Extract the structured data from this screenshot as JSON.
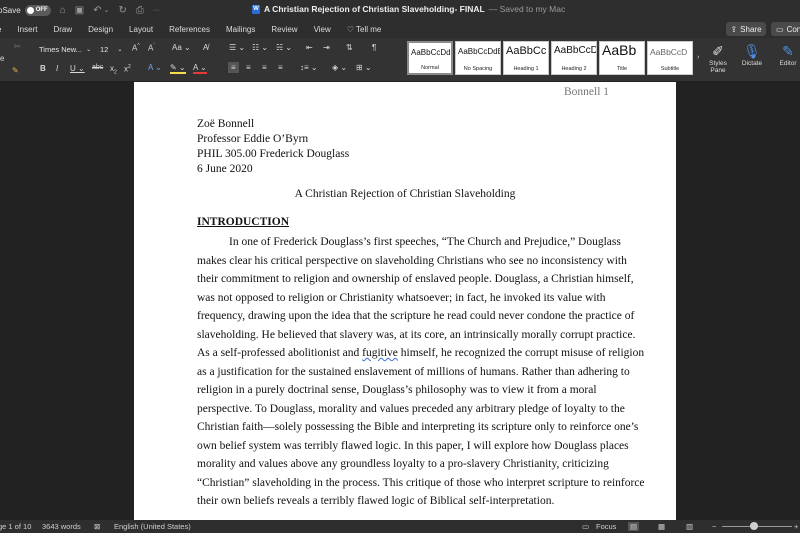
{
  "titlebar": {
    "autosave_label": "oSave",
    "autosave_toggle": "OFF",
    "doc_name": "A Christian Rejection of Christian Slaveholding- FINAL",
    "saved_status": "— Saved to my Mac",
    "word_icon_letter": "W"
  },
  "tabs": [
    "e",
    "Insert",
    "Draw",
    "Design",
    "Layout",
    "References",
    "Mailings",
    "Review",
    "View"
  ],
  "tell_me": "Tell me",
  "share_label": "Share",
  "comments_label": "Con",
  "ribbon": {
    "font_name": "Times New...",
    "font_size": "12",
    "styles": [
      {
        "sample": "AaBbCcDdEe",
        "name": "Normal",
        "active": true
      },
      {
        "sample": "AaBbCcDdEe",
        "name": "No Spacing"
      },
      {
        "sample": "AaBbCc",
        "name": "Heading 1"
      },
      {
        "sample": "AaBbCcD",
        "name": "Heading 2"
      },
      {
        "sample": "AaBb",
        "name": "Title"
      },
      {
        "sample": "AaBbCcD",
        "name": "Subtitle"
      }
    ],
    "styles_pane": "Styles\nPane",
    "dictate": "Dictate",
    "editor": "Editor"
  },
  "document": {
    "page_header": "Bonnell 1",
    "author": "Zoë Bonnell",
    "professor": "Professor Eddie O’Byrn",
    "course": "PHIL 305.00 Frederick Douglass",
    "date": "6 June 2020",
    "title": "A Christian Rejection of Christian Slaveholding",
    "section_heading": "INTRODUCTION",
    "lines": [
      "In one of Frederick Douglass’s first speeches, “The Church and Prejudice,” Douglass",
      "makes clear his critical perspective on slaveholding Christians who see no inconsistency with",
      "their commitment to religion and ownership of enslaved people. Douglass, a Christian himself,",
      "was not opposed to religion or Christianity whatsoever; in fact, he invoked its value with",
      "frequency, drawing upon the idea that the scripture he read could never condone the practice of",
      "slaveholding. He believed that slavery was, at its core, an intrinsically morally corrupt practice.",
      "As a self-professed abolitionist and ",
      "as a justification for the sustained enslavement of millions of humans. Rather than adhering to",
      "religion in a purely doctrinal sense, Douglass’s philosophy was to view it from a moral",
      "perspective. To Douglass, morality and values preceded any arbitrary pledge of loyalty to the",
      "Christian faith—solely possessing the Bible and interpreting its scripture only to reinforce one’s",
      "own belief system was terribly flawed logic. In this paper, I will explore how Douglass places",
      "morality and values above any groundless loyalty to a pro-slavery Christianity, criticizing",
      "“Christian” slaveholding in the process. This critique of those who interpret scripture to reinforce",
      "their own beliefs reveals a terribly flawed logic of Biblical self-interpretation."
    ],
    "flagged_word": "fugitive",
    "line7_tail": " himself, he recognized the corrupt misuse of religion"
  },
  "status": {
    "page": "ge 1 of 10",
    "words": "3643 words",
    "language": "English (United States)",
    "focus": "Focus"
  }
}
